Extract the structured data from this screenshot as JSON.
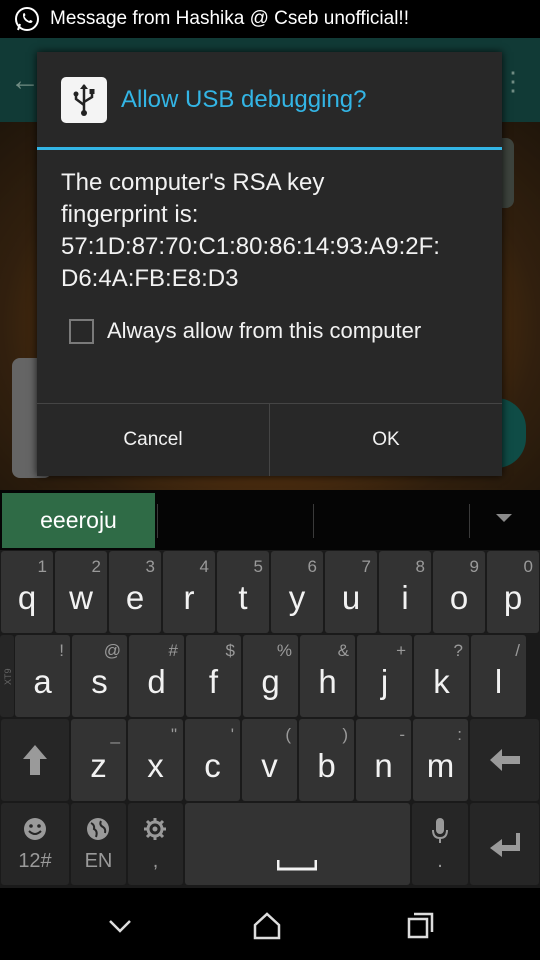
{
  "status_bar": {
    "notification_text": "Message from Hashika @ Cseb unofficial!!",
    "app_icon": "whatsapp-icon"
  },
  "dialog": {
    "icon": "usb-icon",
    "title": "Allow USB debugging?",
    "body_line1": "The computer's RSA key",
    "body_line2": "fingerprint is:",
    "body_line3": "57:1D:87:70:C1:80:86:14:93:A9:2F:",
    "body_line4": "D6:4A:FB:E8:D3",
    "checkbox_label": "Always allow from this computer",
    "checkbox_checked": false,
    "cancel_label": "Cancel",
    "ok_label": "OK",
    "accent_color": "#33b5e5"
  },
  "suggestions": {
    "active": "eeeroju"
  },
  "keyboard": {
    "row1": [
      {
        "main": "q",
        "alt": "1"
      },
      {
        "main": "w",
        "alt": "2"
      },
      {
        "main": "e",
        "alt": "3"
      },
      {
        "main": "r",
        "alt": "4"
      },
      {
        "main": "t",
        "alt": "5"
      },
      {
        "main": "y",
        "alt": "6"
      },
      {
        "main": "u",
        "alt": "7"
      },
      {
        "main": "i",
        "alt": "8"
      },
      {
        "main": "o",
        "alt": "9"
      },
      {
        "main": "p",
        "alt": "0"
      }
    ],
    "row2": [
      {
        "main": "a",
        "alt": "!"
      },
      {
        "main": "s",
        "alt": "@"
      },
      {
        "main": "d",
        "alt": "#"
      },
      {
        "main": "f",
        "alt": "$"
      },
      {
        "main": "g",
        "alt": "%"
      },
      {
        "main": "h",
        "alt": "&"
      },
      {
        "main": "j",
        "alt": "+"
      },
      {
        "main": "k",
        "alt": "?"
      },
      {
        "main": "l",
        "alt": "/"
      }
    ],
    "row2_side_label": "XT9",
    "row3": [
      {
        "main": "z",
        "alt": "_"
      },
      {
        "main": "x",
        "alt": "\""
      },
      {
        "main": "c",
        "alt": "'"
      },
      {
        "main": "v",
        "alt": "("
      },
      {
        "main": "b",
        "alt": ")"
      },
      {
        "main": "n",
        "alt": "-"
      },
      {
        "main": "m",
        "alt": ":"
      }
    ],
    "numbers_label": "12#",
    "language_label": "EN",
    "comma_label": ",",
    "period_label": "."
  },
  "navbar": {
    "back_icon": "back-icon",
    "home_icon": "home-icon",
    "recents_icon": "recents-icon"
  }
}
